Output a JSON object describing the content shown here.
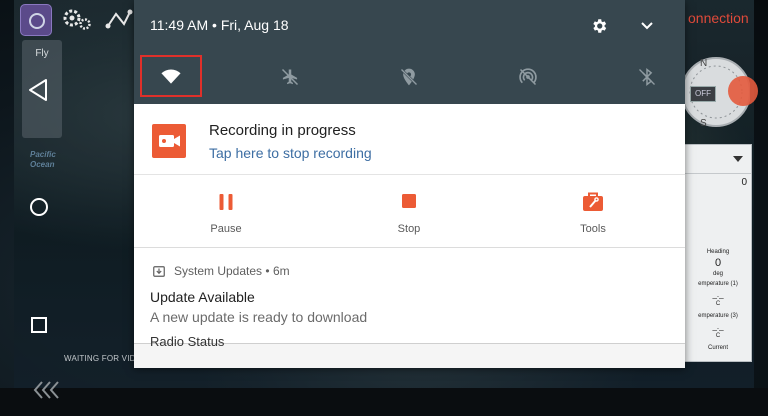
{
  "status_bar": {
    "time": "11:49 AM",
    "separator": "•",
    "date": "Fri, Aug 18"
  },
  "quick_settings": [
    {
      "name": "wifi",
      "state": "on"
    },
    {
      "name": "airplane-mode",
      "state": "off"
    },
    {
      "name": "location",
      "state": "off"
    },
    {
      "name": "hotspot",
      "state": "off"
    },
    {
      "name": "bluetooth",
      "state": "off"
    }
  ],
  "recording": {
    "title": "Recording in progress",
    "subtitle": "Tap here to stop recording",
    "actions": [
      {
        "label": "Pause"
      },
      {
        "label": "Stop"
      },
      {
        "label": "Tools"
      }
    ]
  },
  "system_update": {
    "app": "System Updates",
    "dot": "•",
    "age": "6m",
    "title": "Update Available",
    "body": "A new update is ready to download"
  },
  "peek_next": "Radio Status",
  "background_app": {
    "connection_label": "onnection",
    "fly_label": "Fly",
    "compass_off": "OFF",
    "compass_n": "N",
    "compass_s": "S",
    "map_label_line1": "Pacific",
    "map_label_line2": "Ocean",
    "waiting_text": "WAITING FOR VIDE",
    "telemetry_value": "0",
    "telemetry": [
      {
        "label": "Heading",
        "value": "0",
        "unit": "deg"
      },
      {
        "label": "emperature (1)",
        "value": "_._",
        "unit": "C"
      },
      {
        "label": "emperature (3)",
        "value": "_._",
        "unit": "C"
      },
      {
        "label": "Current",
        "value": "",
        "unit": ""
      }
    ]
  },
  "colors": {
    "shade_header": "#37474f",
    "accent_orange": "#ec5b35",
    "link_blue": "#3d6ea3",
    "highlight_red": "#e0302a"
  }
}
